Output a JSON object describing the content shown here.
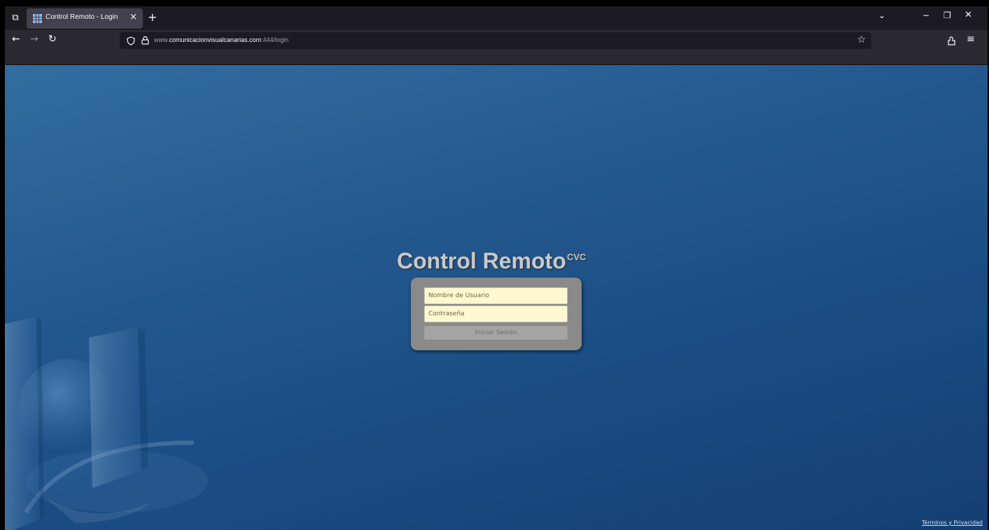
{
  "browser": {
    "tab": {
      "title": "Control Remoto - Login",
      "close": "×"
    },
    "new_tab": "+",
    "tab_overview_icon": "⧉",
    "list_tabs_icon": "⌄",
    "window": {
      "minimize": "−",
      "restore": "❐",
      "close": "✕"
    },
    "nav": {
      "back": "←",
      "forward": "→",
      "reload": "↻"
    },
    "url": {
      "prefix": "www.",
      "host": "comunicacionvisualcanarias.com",
      "path": ":444/login"
    },
    "shield_icon": "♡",
    "lock_icon": "🔒",
    "star_icon": "☆",
    "extensions_icon": "⇧",
    "menu_icon": "≡"
  },
  "page": {
    "title": "Control Remoto",
    "title_sup": "CVC",
    "username_placeholder": "Nombre de Usuario",
    "password_placeholder": "Contraseña",
    "login_button": "Iniciar Sesión",
    "terms_link": "Términos y Privacidad"
  }
}
